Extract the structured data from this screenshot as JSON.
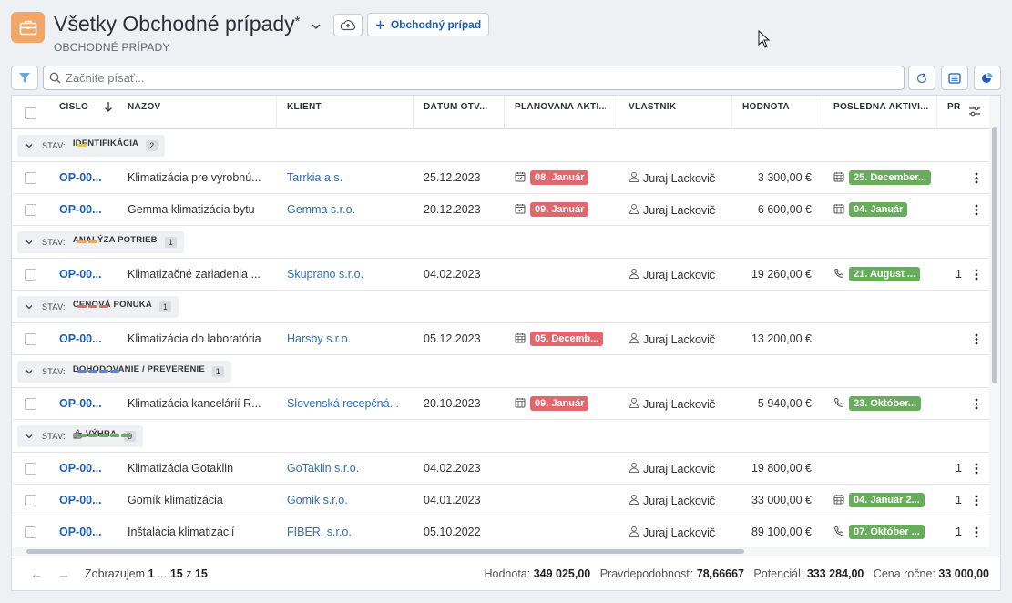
{
  "header": {
    "title": "Všetky Obchodné prípady",
    "title_mark": "*",
    "subtitle": "OBCHODNÉ PRÍPADY",
    "new_button": "Obchodný prípad"
  },
  "search": {
    "placeholder": "Začnite písať..."
  },
  "columns": [
    "ČÍSLO",
    "NÁZOV",
    "KLIENT",
    "DÁTUM OTV...",
    "PLÁNOVANÁ AKTI...",
    "VLASTNÍK",
    "HODNOTA",
    "POSLEDNÁ AKTIVI...",
    "PR"
  ],
  "stav_label": "STAV:",
  "groups": [
    {
      "name": "IDENTIFIKÁCIA",
      "count": "2",
      "color": "#e8c84a",
      "bars": 1
    },
    {
      "name": "ANALÝZA POTRIEB",
      "count": "1",
      "color": "#f0a35a",
      "bars": 2
    },
    {
      "name": "CENOVÁ PONUKA",
      "count": "1",
      "color": "#e0676e",
      "bars": 3
    },
    {
      "name": "DOHODOVANIE / PREVERENIE",
      "count": "1",
      "color": "#5b86c9",
      "bars": 4
    },
    {
      "name": "VÝHRA",
      "count": "9",
      "color": "#67ad5b",
      "bars": 5
    }
  ],
  "rows": [
    {
      "num": "OP-00...",
      "name": "Klimatizácia pre výrobnú...",
      "client": "Tarrkia a.s.",
      "date": "25.12.2023",
      "planned": "08. Január",
      "planned_icon": "calendar-check-icon",
      "owner": "Juraj Lackovič",
      "value": "3 300,00 €",
      "last": "25. December...",
      "last_icon": "calendar-grid-icon",
      "pr": ""
    },
    {
      "num": "OP-00...",
      "name": "Gemma klimatizácia bytu",
      "client": "Gemma s.r.o.",
      "date": "20.12.2023",
      "planned": "09. Január",
      "planned_icon": "calendar-check-icon",
      "owner": "Juraj Lackovič",
      "value": "6 600,00 €",
      "last": "04. Január",
      "last_icon": "calendar-grid-icon",
      "pr": ""
    },
    {
      "num": "OP-00...",
      "name": "Klimatizačné zariadenia ...",
      "client": "Skuprano s.r.o.",
      "date": "04.02.2023",
      "planned": "",
      "planned_icon": "",
      "owner": "Juraj Lackovič",
      "value": "19 260,00 €",
      "last": "21. August ...",
      "last_icon": "phone-icon",
      "pr": "1"
    },
    {
      "num": "OP-00...",
      "name": "Klimatizácia do laboratória",
      "client": "Harsby s.r.o.",
      "date": "05.12.2023",
      "planned": "05. Decemb...",
      "planned_icon": "calendar-grid-icon",
      "owner": "Juraj Lackovič",
      "value": "13 200,00 €",
      "last": "",
      "last_icon": "",
      "pr": ""
    },
    {
      "num": "OP-00...",
      "name": "Klimatizácia kancelárií R...",
      "client": "Slovenská recepčná...",
      "date": "20.10.2023",
      "planned": "09. Január",
      "planned_icon": "calendar-grid-icon",
      "owner": "Juraj Lackovič",
      "value": "5 940,00 €",
      "last": "23. Október...",
      "last_icon": "phone-icon",
      "pr": ""
    },
    {
      "num": "OP-00...",
      "name": "Klimatizácia Gotaklin",
      "client": "GoTaklin s.r.o.",
      "date": "04.02.2023",
      "planned": "",
      "planned_icon": "",
      "owner": "Juraj Lackovič",
      "value": "19 800,00 €",
      "last": "",
      "last_icon": "",
      "pr": "1"
    },
    {
      "num": "OP-00...",
      "name": "Gomík klimatizácia",
      "client": "Gomik s.r.o.",
      "date": "04.01.2023",
      "planned": "",
      "planned_icon": "",
      "owner": "Juraj Lackovič",
      "value": "33 000,00 €",
      "last": "04. Január 2...",
      "last_icon": "calendar-grid-icon",
      "pr": "1"
    },
    {
      "num": "OP-00...",
      "name": "Inštalácia klimatizácií",
      "client": "FIBER, s.r.o.",
      "date": "05.10.2022",
      "planned": "",
      "planned_icon": "",
      "owner": "Juraj Lackovič",
      "value": "89 100,00 €",
      "last": "07. Október ...",
      "last_icon": "phone-icon",
      "pr": "1"
    }
  ],
  "footer": {
    "showing_prefix": "Zobrazujem",
    "range_start": "1",
    "range_dots": "...",
    "range_end": "15",
    "of": "z",
    "total": "15",
    "stat1_label": "Hodnota:",
    "stat1_value": "349 025,00",
    "stat2_label": "Pravdepodobnosť:",
    "stat2_value": "78,66667",
    "stat3_label": "Potenciál:",
    "stat3_value": "333 284,00",
    "stat4_label": "Cena ročne:",
    "stat4_value": "33 000,00"
  },
  "colors": {
    "accent": "#1d5fb8",
    "app_icon": "#f2a766"
  }
}
